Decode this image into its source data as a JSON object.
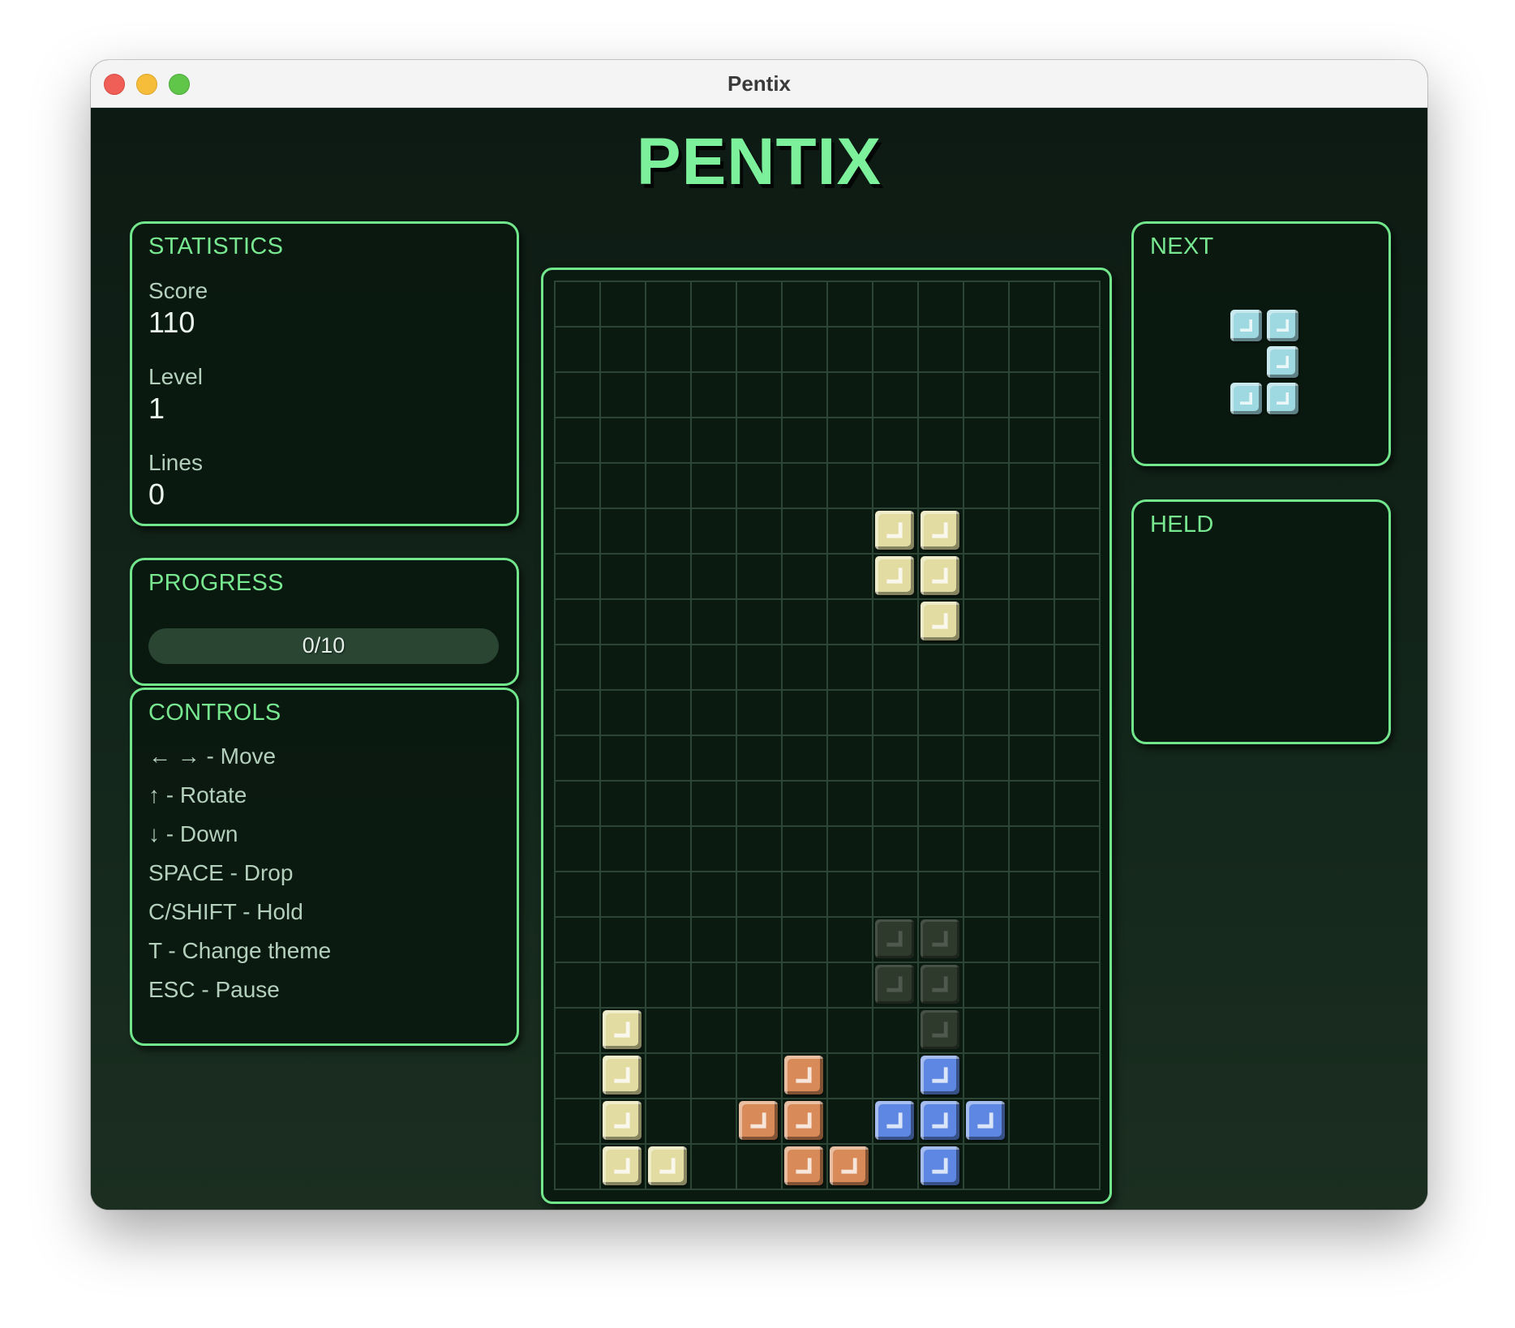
{
  "window": {
    "title": "Pentix"
  },
  "game": {
    "title": "PENTIX"
  },
  "statistics": {
    "title": "STATISTICS",
    "score_label": "Score",
    "score": "110",
    "level_label": "Level",
    "level": "1",
    "lines_label": "Lines",
    "lines": "0"
  },
  "progress": {
    "title": "PROGRESS",
    "text": "0/10",
    "fraction": 0
  },
  "controls": {
    "title": "CONTROLS",
    "items": [
      "← → - Move",
      "↑ - Rotate",
      "↓ - Down",
      "SPACE - Drop",
      "C/SHIFT - Hold",
      "T - Change theme",
      "ESC - Pause"
    ]
  },
  "next": {
    "title": "NEXT",
    "color": "#9ed8e0",
    "cells": [
      [
        0,
        0
      ],
      [
        1,
        0
      ],
      [
        1,
        1
      ],
      [
        0,
        2
      ],
      [
        1,
        2
      ]
    ]
  },
  "held": {
    "title": "HELD"
  },
  "board": {
    "cols": 12,
    "rows": 20,
    "colors": {
      "yellow": "#e2dca2",
      "orange": "#d88a58",
      "blue": "#5d87e2",
      "ghost": "#2e3a2c"
    },
    "active_piece": {
      "color": "yellow",
      "cells": [
        [
          7,
          5
        ],
        [
          8,
          5
        ],
        [
          7,
          6
        ],
        [
          8,
          6
        ],
        [
          8,
          7
        ]
      ]
    },
    "ghost_piece": {
      "cells": [
        [
          7,
          14
        ],
        [
          8,
          14
        ],
        [
          7,
          15
        ],
        [
          8,
          15
        ],
        [
          8,
          16
        ]
      ]
    },
    "locked": [
      {
        "x": 1,
        "y": 16,
        "color": "yellow"
      },
      {
        "x": 1,
        "y": 17,
        "color": "yellow"
      },
      {
        "x": 1,
        "y": 18,
        "color": "yellow"
      },
      {
        "x": 1,
        "y": 19,
        "color": "yellow"
      },
      {
        "x": 2,
        "y": 19,
        "color": "yellow"
      },
      {
        "x": 5,
        "y": 17,
        "color": "orange"
      },
      {
        "x": 4,
        "y": 18,
        "color": "orange"
      },
      {
        "x": 5,
        "y": 18,
        "color": "orange"
      },
      {
        "x": 5,
        "y": 19,
        "color": "orange"
      },
      {
        "x": 6,
        "y": 19,
        "color": "orange"
      },
      {
        "x": 8,
        "y": 17,
        "color": "blue"
      },
      {
        "x": 7,
        "y": 18,
        "color": "blue"
      },
      {
        "x": 8,
        "y": 18,
        "color": "blue"
      },
      {
        "x": 9,
        "y": 18,
        "color": "blue"
      },
      {
        "x": 8,
        "y": 19,
        "color": "blue"
      }
    ]
  }
}
